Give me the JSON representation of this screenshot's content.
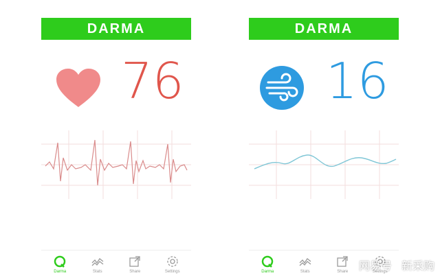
{
  "colors": {
    "brand": "#2ecc1c",
    "heart_rate": "#e0564c",
    "respiration": "#2e9be0",
    "ecg_line": "#d98a8a",
    "resp_line": "#7fc6d6",
    "grid": "#f0d6d6",
    "tab_inactive": "#9a9a9a"
  },
  "screens": [
    {
      "brand": "DARMA",
      "icon": "heart-icon",
      "value": "76",
      "tabs": [
        {
          "icon": "darma-logo-icon",
          "label": "Darma",
          "active": true
        },
        {
          "icon": "stats-icon",
          "label": "Stats",
          "active": false
        },
        {
          "icon": "share-icon",
          "label": "Share",
          "active": false
        },
        {
          "icon": "settings-gear-icon",
          "label": "Settings",
          "active": false
        }
      ]
    },
    {
      "brand": "DARMA",
      "icon": "wind-icon",
      "value": "16",
      "tabs": [
        {
          "icon": "darma-logo-icon",
          "label": "Darma",
          "active": true
        },
        {
          "icon": "stats-icon",
          "label": "Stats",
          "active": false
        },
        {
          "icon": "share-icon",
          "label": "Share",
          "active": false
        },
        {
          "icon": "settings-gear-icon",
          "label": "Settings",
          "active": false
        }
      ]
    }
  ],
  "watermark": {
    "left": "网易号",
    "right": "新采购"
  }
}
